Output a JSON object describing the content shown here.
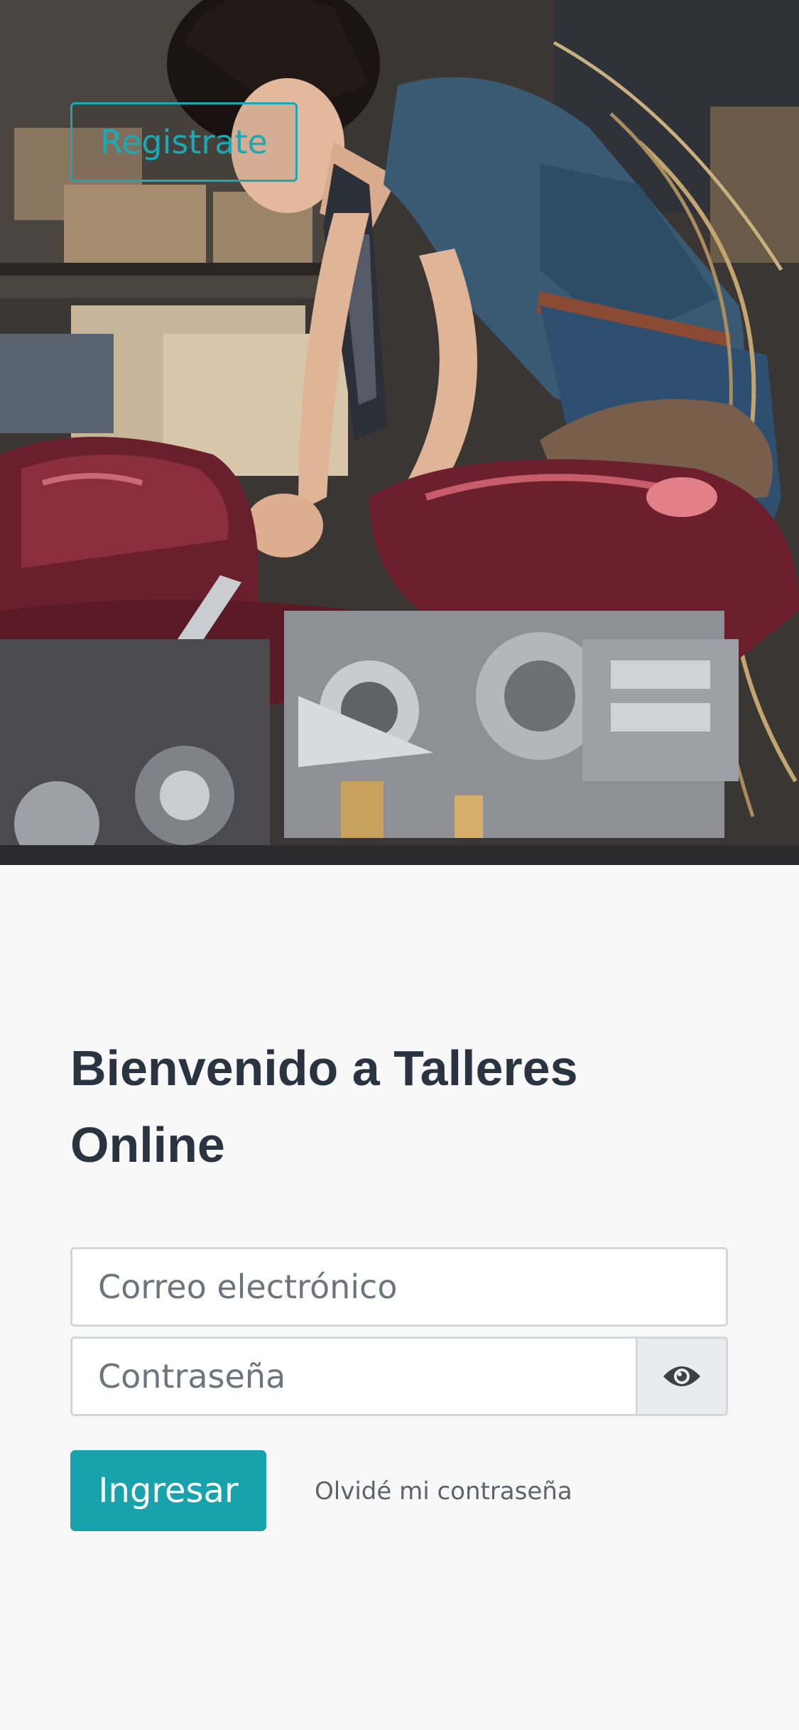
{
  "hero": {
    "image_icon": "motorcycle-workshop-photo",
    "register_label": "Registrate"
  },
  "login": {
    "title_line1": "Bienvenido a Talleres",
    "title_line2": "Online",
    "email_placeholder": "Correo electrónico",
    "email_value": "",
    "password_placeholder": "Contraseña",
    "password_value": "",
    "toggle_icon": "eye-icon",
    "submit_label": "Ingresar",
    "forgot_label": "Olvidé mi contraseña"
  },
  "colors": {
    "accent": "#17a2ac",
    "background": "#f8f8f9",
    "title": "#2a3340"
  }
}
